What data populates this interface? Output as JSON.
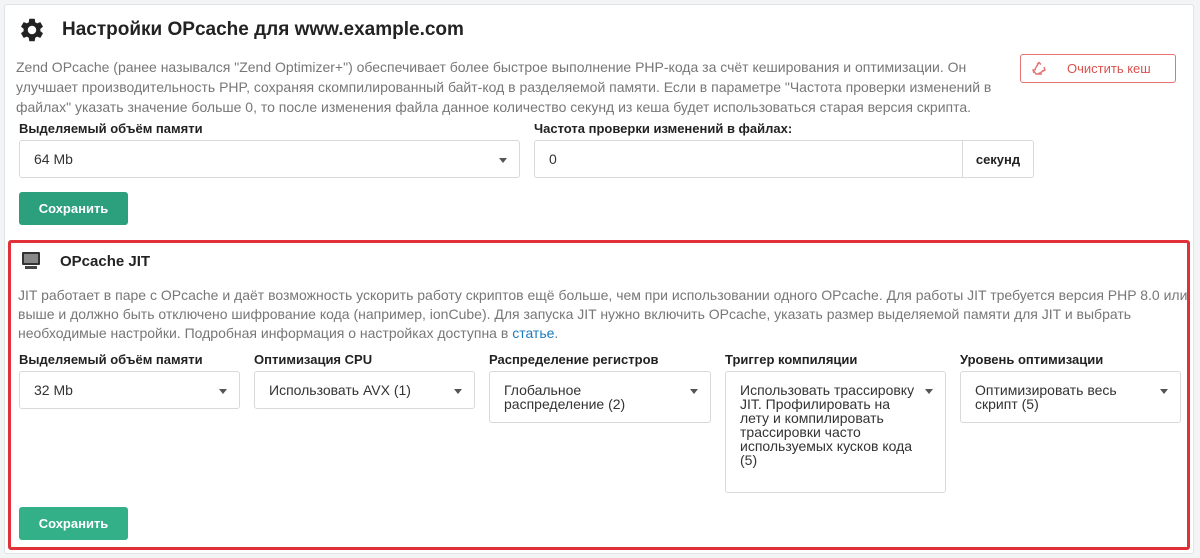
{
  "opcache": {
    "title": "Настройки OPcache для www.example.com",
    "description": "Zend OPcache (ранее назывался \"Zend Optimizer+\") обеспечивает более быстрое выполнение PHP-кода за счёт кеширования и оптимизации. Он улучшает производительность PHP, сохраняя скомпилированный байт-код в разделяемой памяти. Если в параметре \"Частота проверки изменений в файлах\" указать значение больше 0, то после изменения файла данное количество секунд из кеша будет использоваться старая версия скрипта.",
    "clear_cache_label": "Очистить кеш",
    "memory_label": "Выделяемый объём памяти",
    "memory_value": "64 Mb",
    "revalidate_label": "Частота проверки изменений в файлах:",
    "revalidate_value": "0",
    "revalidate_unit": "секунд",
    "save_label": "Сохранить"
  },
  "jit": {
    "title": "OPcache JIT",
    "description": "JIT работает в паре с OPcache и даёт возможность ускорить работу скриптов ещё больше, чем при использовании одного OPcache. Для работы JIT требуется версия PHP 8.0 или выше и должно быть отключено шифрование кода (например, ionCube). Для запуска JIT нужно включить OPcache, указать размер выделяемой памяти для JIT и выбрать необходимые настройки. Подробная информация о настройках доступна в ",
    "link_text": "статье",
    "description_end": ".",
    "fields": [
      {
        "label": "Выделяемый объём памяти",
        "value": "32 Mb"
      },
      {
        "label": "Оптимизация CPU",
        "value": "Использовать AVX (1)"
      },
      {
        "label": "Распределение регистров",
        "value": "Глобальное распределение (2)"
      },
      {
        "label": "Триггер компиляции",
        "value": "Использовать трассировку JIT. Профилировать на лету и компилировать трассировки часто используемых кусков кода (5)"
      },
      {
        "label": "Уровень оптимизации",
        "value": "Оптимизировать весь скрипт (5)"
      }
    ],
    "save_label": "Сохранить"
  },
  "colors": {
    "accent": "#2c9f7d",
    "highlight_border": "#e0303a",
    "danger": "#d9534f",
    "link": "#1a7bbf"
  }
}
